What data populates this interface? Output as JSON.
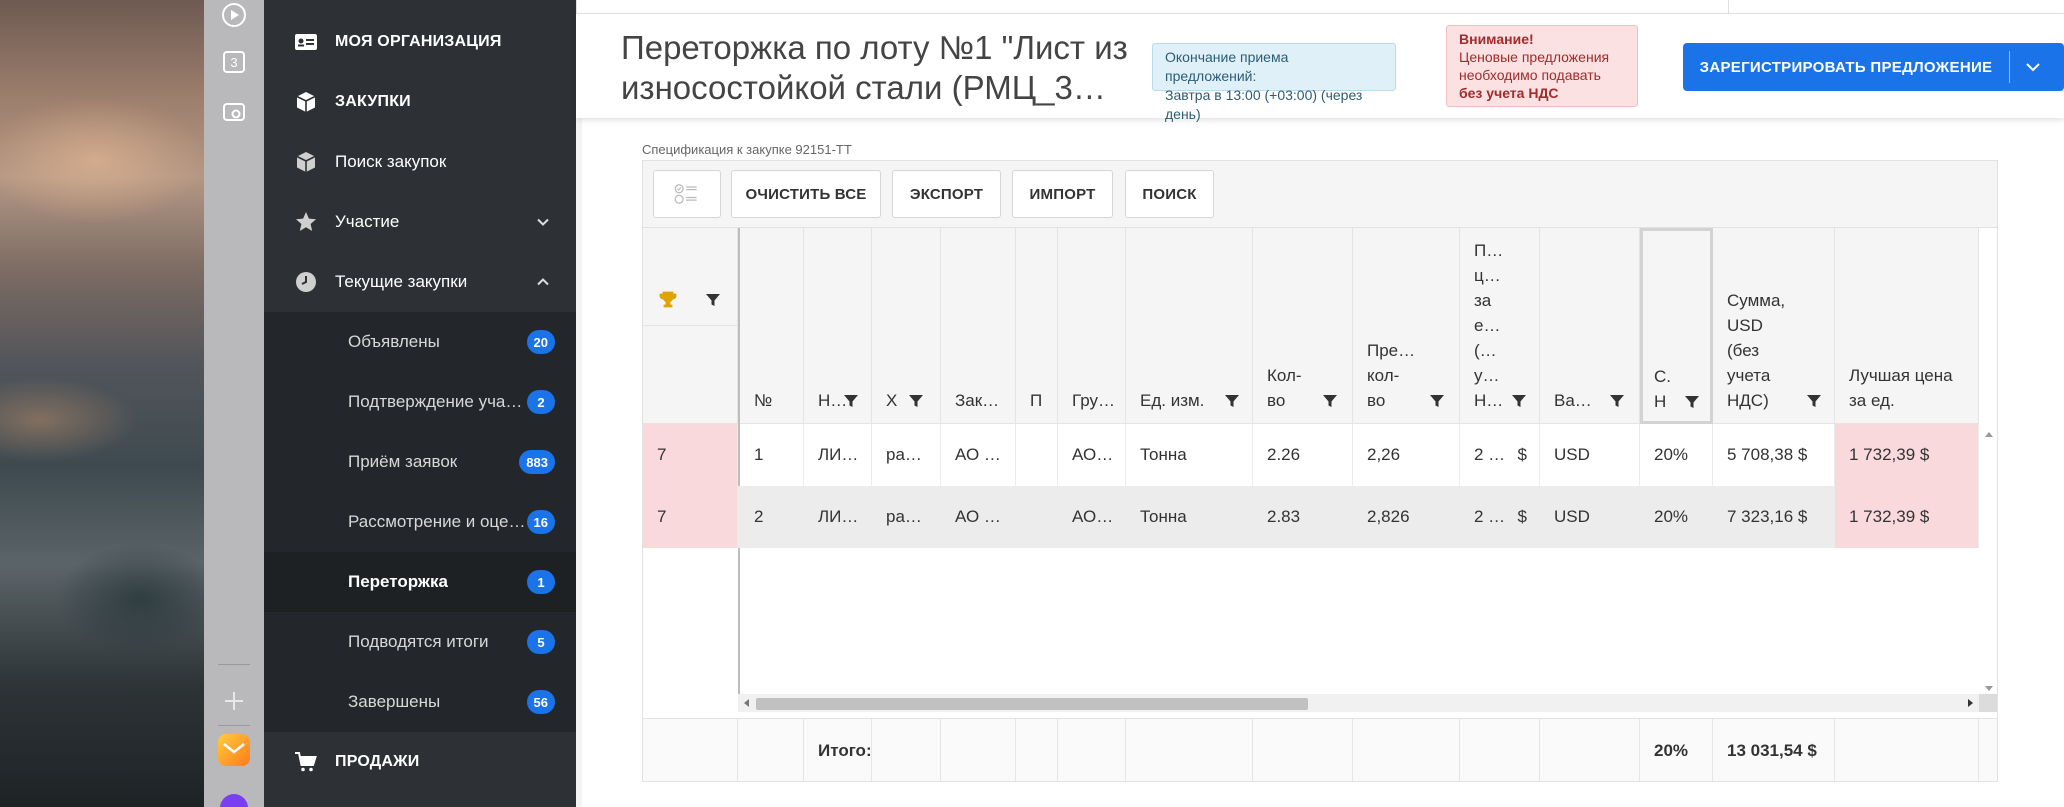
{
  "dock": {
    "badge_number": "3"
  },
  "sidebar": {
    "org": "МОЯ ОРГАНИЗАЦИЯ",
    "purchases": "ЗАКУПКИ",
    "search": "Поиск закупок",
    "participation": "Участие",
    "current": "Текущие закупки",
    "sub": [
      {
        "label": "Объявлены",
        "count": "20"
      },
      {
        "label": "Подтверждение участия",
        "count": "2"
      },
      {
        "label": "Приём заявок",
        "count": "883"
      },
      {
        "label": "Рассмотрение и оценка",
        "count": "16"
      },
      {
        "label": "Переторжка",
        "count": "1"
      },
      {
        "label": "Подводятся итоги",
        "count": "5"
      },
      {
        "label": "Завершены",
        "count": "56"
      }
    ],
    "sales": "ПРОДАЖИ"
  },
  "header": {
    "title": "Переторжка по лоту №1 \"Лист из износостойкой стали (РМЦ_3…",
    "deadline_line1": "Окончание приема предложений:",
    "deadline_line2": "Завтра в 13:00 (+03:00) (через день)",
    "warn_title": "Внимание!",
    "warn_line1": "Ценовые предложения",
    "warn_line2": "необходимо подавать",
    "warn_bold": "без учета НДС",
    "register_label": "ЗАРЕГИСТРИРОВАТЬ ПРЕДЛОЖЕНИЕ"
  },
  "spec": {
    "label": "Спецификация к закупке 92151-ТТ",
    "buttons": {
      "clear": "ОЧИСТИТЬ ВСЕ",
      "export": "ЭКСПОРТ",
      "import": "ИМПОРТ",
      "search": "ПОИСК"
    }
  },
  "table": {
    "headers": {
      "num": "№",
      "name": "Н…",
      "char": "Х",
      "customer": "Зак…",
      "p": "П",
      "group": "Гру…",
      "unit": "Ед. изм.",
      "qty": "Кол-\nво",
      "pre_qty": "Пре…\nкол-\nво",
      "price": "П…\nц…\nза\nе…\n(…\nу…\nН…",
      "currency": "Ва…",
      "vat": "С.\nН",
      "sum": "Сумма,\nUSD\n(без\nучета\nНДС)",
      "best": "Лучшая цена\nза ед."
    },
    "rows": [
      {
        "rank": "7",
        "num": "1",
        "name": "ЛИ…",
        "char": "ра…",
        "customer": "АО …",
        "p": "",
        "group": "АО…",
        "unit": "Тонна",
        "qty": "2.26",
        "pre_qty": "2,26",
        "price": "2 …",
        "price_cur": "$",
        "currency": "USD",
        "vat": "20%",
        "sum": "5 708,38 $",
        "best": "1 732,39 $"
      },
      {
        "rank": "7",
        "num": "2",
        "name": "ЛИ…",
        "char": "ра…",
        "customer": "АО …",
        "p": "",
        "group": "АО…",
        "unit": "Тонна",
        "qty": "2.83",
        "pre_qty": "2,826",
        "price": "2 …",
        "price_cur": "$",
        "currency": "USD",
        "vat": "20%",
        "sum": "7 323,16 $",
        "best": "1 732,39 $"
      }
    ],
    "footer": {
      "label": "Итого:",
      "vat": "20%",
      "total": "13 031,54 $"
    }
  }
}
